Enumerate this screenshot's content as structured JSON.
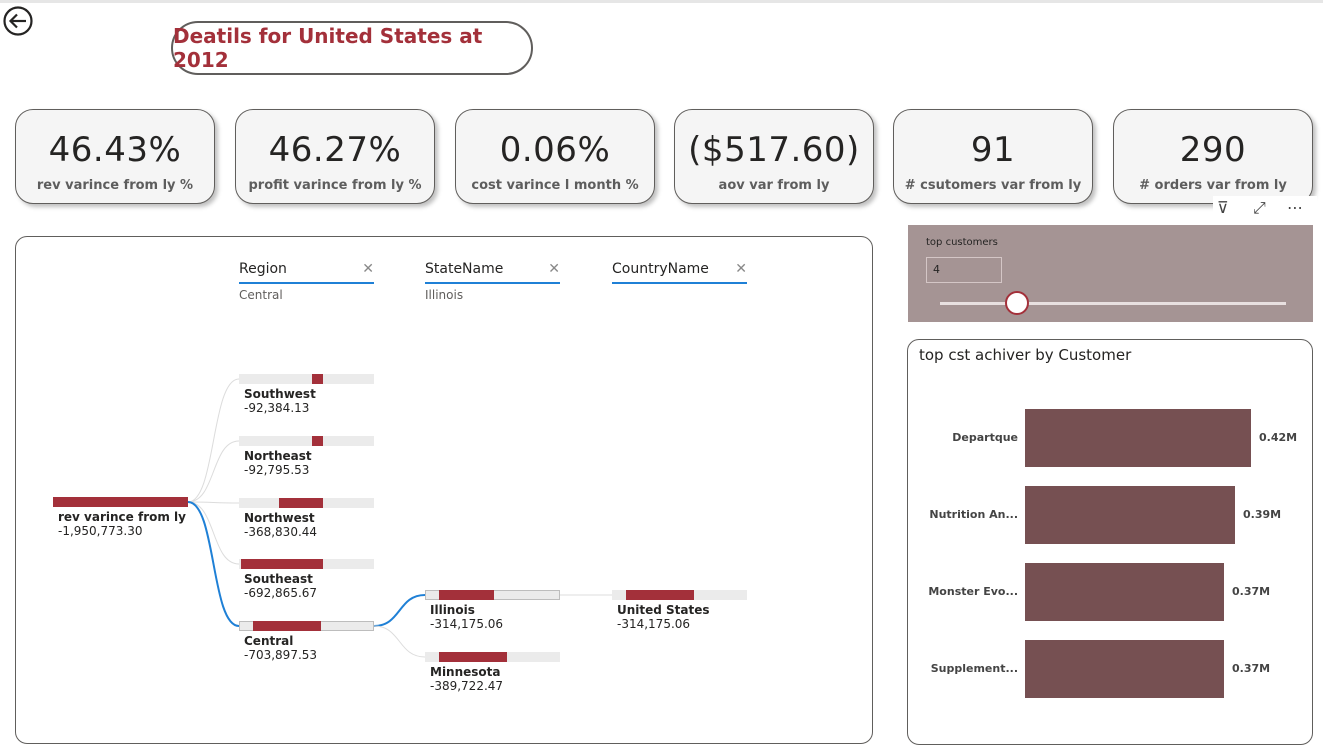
{
  "header": {
    "title": "Deatils for United States at 2012"
  },
  "kpis": [
    {
      "value": "46.43%",
      "label": "rev varince from ly %"
    },
    {
      "value": "46.27%",
      "label": "profit varince from ly %"
    },
    {
      "value": "0.06%",
      "label": "cost varince l month %"
    },
    {
      "value": "($517.60)",
      "label": "aov var from ly"
    },
    {
      "value": "91",
      "label": "# csutomers var from ly"
    },
    {
      "value": "290",
      "label": "# orders var from ly"
    }
  ],
  "tree": {
    "headers": [
      {
        "name": "Region",
        "selected": "Central"
      },
      {
        "name": "StateName",
        "selected": "Illinois"
      },
      {
        "name": "CountryName",
        "selected": ""
      }
    ],
    "root": {
      "label": "rev varince from ly",
      "value": "-1,950,773.30"
    },
    "regions": [
      {
        "label": "Southwest",
        "value": "-92,384.13",
        "fraction": 0.13
      },
      {
        "label": "Northeast",
        "value": "-92,795.53",
        "fraction": 0.13
      },
      {
        "label": "Northwest",
        "value": "-368,830.44",
        "fraction": 0.52
      },
      {
        "label": "Southeast",
        "value": "-692,865.67",
        "fraction": 0.98
      },
      {
        "label": "Central",
        "value": "-703,897.53",
        "fraction": 1.0
      }
    ],
    "states": [
      {
        "label": "Illinois",
        "value": "-314,175.06",
        "fraction": 0.81
      },
      {
        "label": "Minnesota",
        "value": "-389,722.47",
        "fraction": 1.0
      }
    ],
    "countries": [
      {
        "label": "United States",
        "value": "-314,175.06",
        "fraction": 1.0
      }
    ]
  },
  "slicer": {
    "title": "top customers",
    "value": "4",
    "position": 0.2
  },
  "toolbar": {
    "filter_icon": "⊽",
    "focus_icon": "⤢",
    "more_icon": "⋯"
  },
  "bar_chart": {
    "title": "top cst achiver by Customer"
  },
  "chart_data": {
    "type": "bar",
    "orientation": "horizontal",
    "title": "top cst achiver by Customer",
    "categories": [
      "Departque",
      "Nutrition An...",
      "Monster Evo...",
      "Supplement..."
    ],
    "values": [
      0.42,
      0.39,
      0.37,
      0.37
    ],
    "value_labels": [
      "0.42M",
      "0.39M",
      "0.37M",
      "0.37M"
    ],
    "unit": "M",
    "xlim": [
      0,
      0.42
    ],
    "bar_color": "#765052"
  },
  "colors": {
    "accent": "#a3303a",
    "connector": "#1f80d6",
    "slicer_bg": "#a59494",
    "bar": "#765052"
  }
}
